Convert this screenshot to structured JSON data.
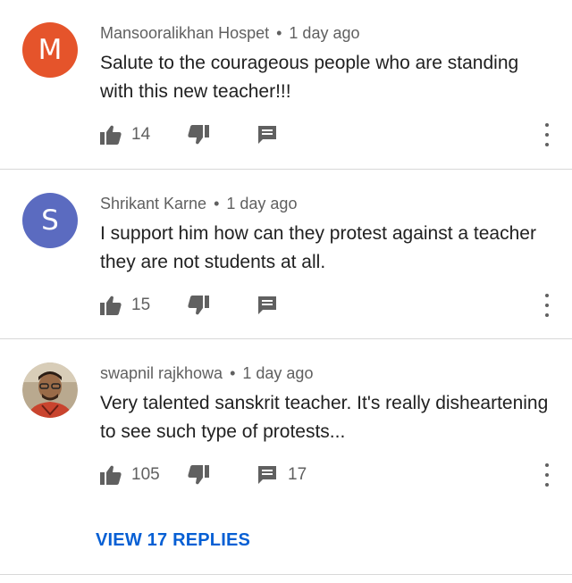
{
  "comments": [
    {
      "avatar_letter": "M",
      "avatar_color": "#e5542b",
      "author": "Mansooralikhan Hospet",
      "separator": "•",
      "time": "1 day ago",
      "text": "Salute to the courageous people who are standing with this new teacher!!!",
      "likes": "14",
      "replies": ""
    },
    {
      "avatar_letter": "S",
      "avatar_color": "#5b6bc0",
      "author": "Shrikant Karne",
      "separator": "•",
      "time": "1 day ago",
      "text": "I support him how can they protest against a teacher they are not students at all.",
      "likes": "15",
      "replies": ""
    },
    {
      "avatar_letter": "",
      "avatar_color": "#8a6a4a",
      "author": "swapnil rajkhowa",
      "separator": "•",
      "time": "1 day ago",
      "text": "Very talented sanskrit teacher. It's really disheartening to see such type of protests...",
      "likes": "105",
      "replies": "17",
      "view_replies_label": "VIEW 17 REPLIES"
    }
  ],
  "icons": {
    "like": "thumb-up-icon",
    "dislike": "thumb-down-icon",
    "reply": "reply-icon",
    "more": "more-vert-icon"
  },
  "colors": {
    "link_blue": "#065fd4",
    "secondary_text": "#606060",
    "primary_text": "#212121"
  }
}
